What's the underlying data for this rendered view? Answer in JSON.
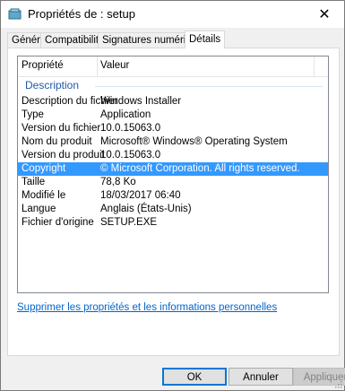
{
  "window": {
    "title": "Propriétés de : setup"
  },
  "tabs": [
    {
      "label": "Général"
    },
    {
      "label": "Compatibilité"
    },
    {
      "label": "Signatures numériques"
    },
    {
      "label": "Détails"
    }
  ],
  "list": {
    "columns": {
      "property": "Propriété",
      "value": "Valeur"
    },
    "group": "Description",
    "rows": [
      {
        "key": "Description du fichier",
        "value": "Windows Installer"
      },
      {
        "key": "Type",
        "value": "Application"
      },
      {
        "key": "Version du fichier",
        "value": "10.0.15063.0"
      },
      {
        "key": "Nom du produit",
        "value": "Microsoft® Windows® Operating System"
      },
      {
        "key": "Version du produit",
        "value": "10.0.15063.0"
      },
      {
        "key": "Copyright",
        "value": "© Microsoft Corporation. All rights reserved."
      },
      {
        "key": "Taille",
        "value": "78,8 Ko"
      },
      {
        "key": "Modifié le",
        "value": "18/03/2017 06:40"
      },
      {
        "key": "Langue",
        "value": "Anglais (États-Unis)"
      },
      {
        "key": "Fichier d'origine",
        "value": "SETUP.EXE"
      }
    ]
  },
  "link": "Supprimer les propriétés et les informations personnelles",
  "buttons": {
    "ok": "OK",
    "cancel": "Annuler",
    "apply": "Appliquer"
  },
  "colors": {
    "selection": "#3399ff",
    "link": "#0066cc",
    "group": "#1e5aa8"
  }
}
